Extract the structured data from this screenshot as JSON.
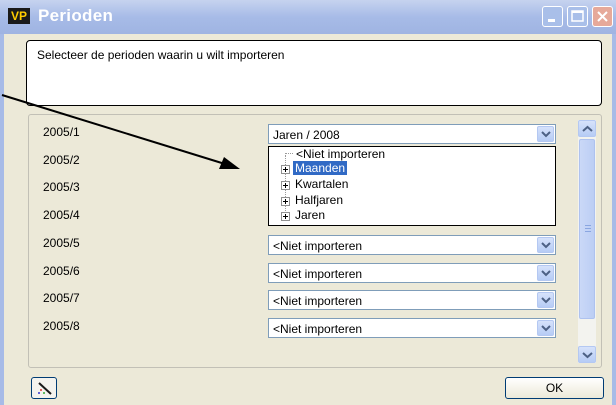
{
  "window": {
    "app_icon_text": "VP",
    "title": "Perioden"
  },
  "info": {
    "text": "Selecteer de perioden waarin u wilt importeren"
  },
  "periods": [
    {
      "label": "2005/1",
      "value": "Jaren / 2008"
    },
    {
      "label": "2005/2",
      "value": ""
    },
    {
      "label": "2005/3",
      "value": ""
    },
    {
      "label": "2005/4",
      "value": ""
    },
    {
      "label": "2005/5",
      "value": "<Niet importeren"
    },
    {
      "label": "2005/6",
      "value": "<Niet importeren"
    },
    {
      "label": "2005/7",
      "value": "<Niet importeren"
    },
    {
      "label": "2005/8",
      "value": "<Niet importeren"
    }
  ],
  "dropdown": {
    "items": [
      {
        "label": "<Niet importeren",
        "expandable": false,
        "selected": false
      },
      {
        "label": "Maanden",
        "expandable": true,
        "selected": true
      },
      {
        "label": "Kwartalen",
        "expandable": true,
        "selected": false
      },
      {
        "label": "Halfjaren",
        "expandable": true,
        "selected": false
      },
      {
        "label": "Jaren",
        "expandable": true,
        "selected": false
      }
    ]
  },
  "footer": {
    "ok_label": "OK"
  },
  "colors": {
    "selection": "#316ac5",
    "titlebar": "#a7bbe7",
    "dialog_bg": "#ece9d8"
  }
}
